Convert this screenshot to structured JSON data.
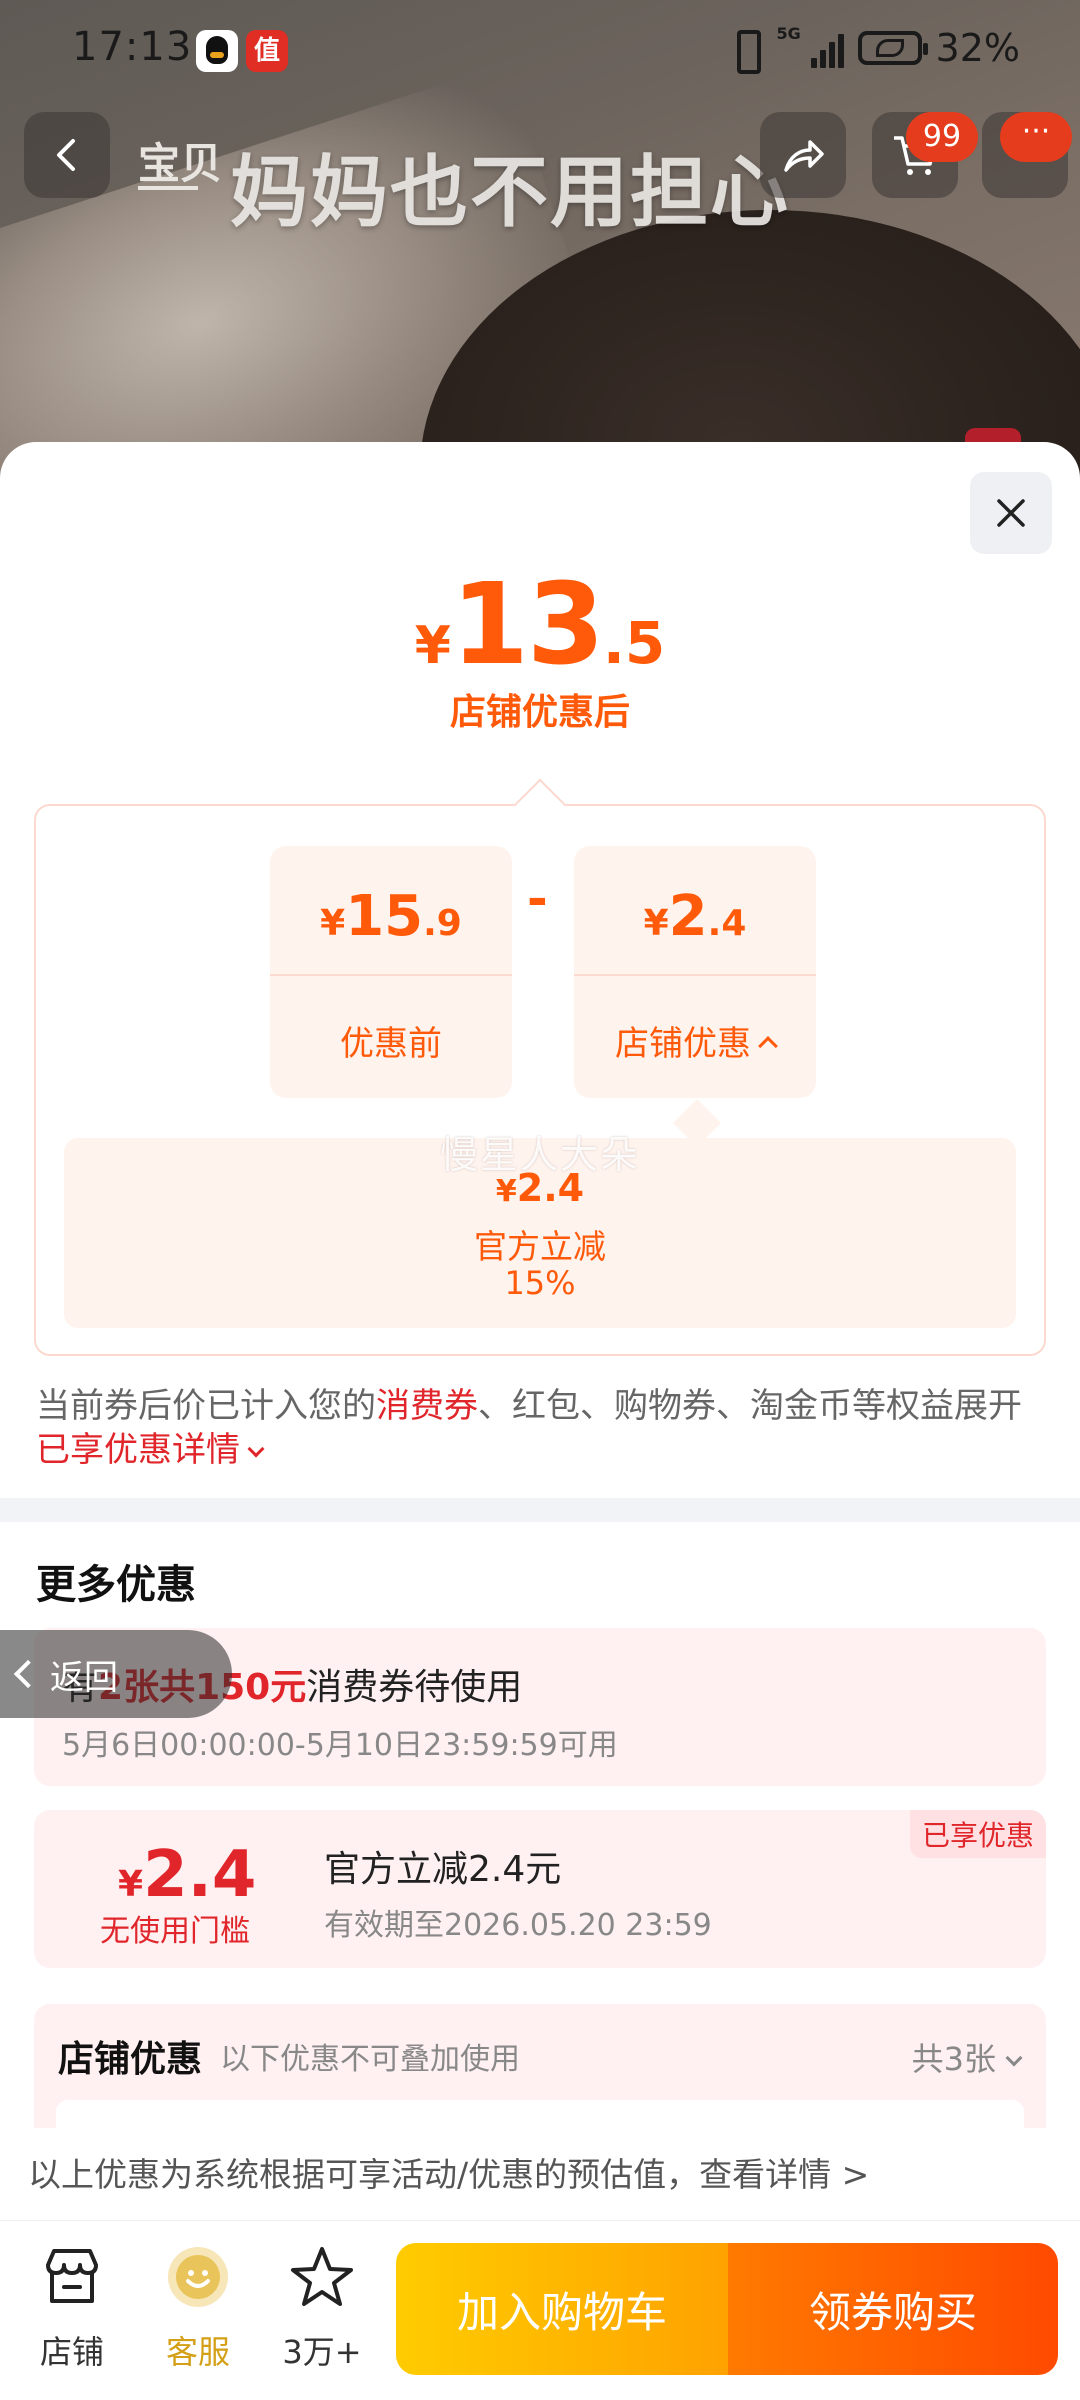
{
  "status_bar": {
    "time": "17:13",
    "network": "5G",
    "battery": "32%",
    "app_icon_zhi": "值"
  },
  "header": {
    "label": "宝贝",
    "hero_text": "妈妈也不用担心",
    "cart_badge": "99",
    "more_dots": "···"
  },
  "price": {
    "symbol": "¥",
    "integer": "13",
    "decimal": ".5",
    "caption": "店铺优惠后"
  },
  "breakdown": {
    "before": {
      "symbol": "¥",
      "integer": "15",
      "decimal": ".9",
      "label": "优惠前"
    },
    "minus": "-",
    "store": {
      "symbol": "¥",
      "integer": "2",
      "decimal": ".4",
      "label": "店铺优惠"
    },
    "sub": {
      "watermark": "慢星人大朵",
      "symbol": "¥",
      "amount": "2.4",
      "name": "官方立减",
      "percent": "15%"
    }
  },
  "note": {
    "part1": "当前券后价已计入您的",
    "highlight1": "消费券",
    "part2": "、红包、购物券、淘金币等权益展开",
    "highlight2": "已享优惠详情"
  },
  "more": {
    "title": "更多优惠",
    "back_pill": "返回",
    "card1": {
      "prefix": "有",
      "highlight": "2张共150元",
      "suffix": "消费券待使用",
      "time": "5月6日00:00:00-5月10日23:59:59可用"
    },
    "card2": {
      "symbol": "¥",
      "amount": "2.4",
      "threshold": "无使用门槛",
      "title": "官方立减2.4元",
      "valid": "有效期至2026.05.20 23:59",
      "badge": "已享优惠"
    },
    "card3": {
      "title": "店铺优惠",
      "subtitle": "以下优惠不可叠加使用",
      "count": "共3张"
    }
  },
  "footer_note": "以上优惠为系统根据可享活动/优惠的预估值，查看详情 >",
  "bottom_bar": {
    "shop": "店铺",
    "service": "客服",
    "fav": "3万+",
    "add_cart": "加入购物车",
    "buy": "领券购买"
  },
  "colors": {
    "accent": "#ff5a0a",
    "red": "#e0262b",
    "cart_btn": "#ffb300",
    "buy_btn": "#ff5a00"
  }
}
